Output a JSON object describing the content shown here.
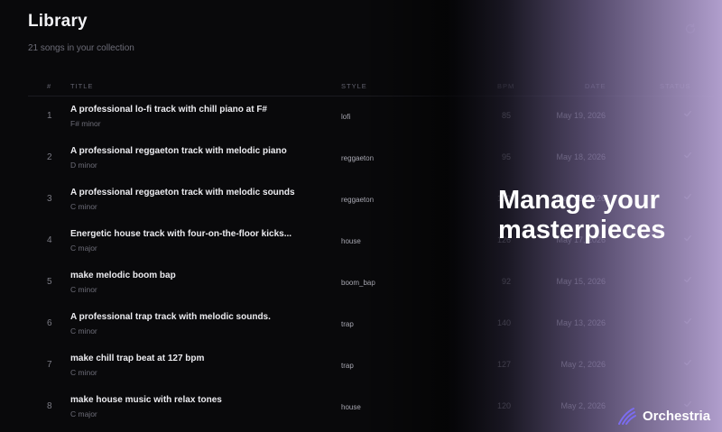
{
  "header": {
    "title": "Library",
    "subtitle": "21 songs in your collection"
  },
  "icons": {
    "refresh": "refresh-icon",
    "status": "check-icon",
    "logo": "orchestria-logo-icon"
  },
  "table": {
    "columns": [
      "#",
      "TITLE",
      "STYLE",
      "BPM",
      "DATE",
      "STATUS"
    ],
    "rows": [
      {
        "num": "1",
        "title": "A professional lo-fi track with chill piano at F#",
        "key": "F# minor",
        "style": "lofi",
        "bpm": "85",
        "date": "May 19, 2026"
      },
      {
        "num": "2",
        "title": "A professional reggaeton track with melodic piano",
        "key": "D minor",
        "style": "reggaeton",
        "bpm": "95",
        "date": "May 18, 2026"
      },
      {
        "num": "3",
        "title": "A professional reggaeton track with melodic sounds",
        "key": "C minor",
        "style": "reggaeton",
        "bpm": "100",
        "date": "May 18, 2026"
      },
      {
        "num": "4",
        "title": "Energetic house track with four-on-the-floor kicks...",
        "key": "C major",
        "style": "house",
        "bpm": "126",
        "date": "May 17, 2026"
      },
      {
        "num": "5",
        "title": "make melodic boom bap",
        "key": "C minor",
        "style": "boom_bap",
        "bpm": "92",
        "date": "May 15, 2026"
      },
      {
        "num": "6",
        "title": "A professional trap track with melodic sounds.",
        "key": "C minor",
        "style": "trap",
        "bpm": "140",
        "date": "May 13, 2026"
      },
      {
        "num": "7",
        "title": "make chill trap beat at 127 bpm",
        "key": "C minor",
        "style": "trap",
        "bpm": "127",
        "date": "May 2, 2026"
      },
      {
        "num": "8",
        "title": "make house music with relax tones",
        "key": "C major",
        "style": "house",
        "bpm": "120",
        "date": "May 2, 2026"
      }
    ]
  },
  "hero": {
    "line1": "Manage your",
    "line2": "masterpieces"
  },
  "brand": {
    "name": "Orchestria"
  },
  "colors": {
    "background": "#09090b",
    "accent": "#b9a6d7",
    "logo": "#7b6cf0"
  }
}
